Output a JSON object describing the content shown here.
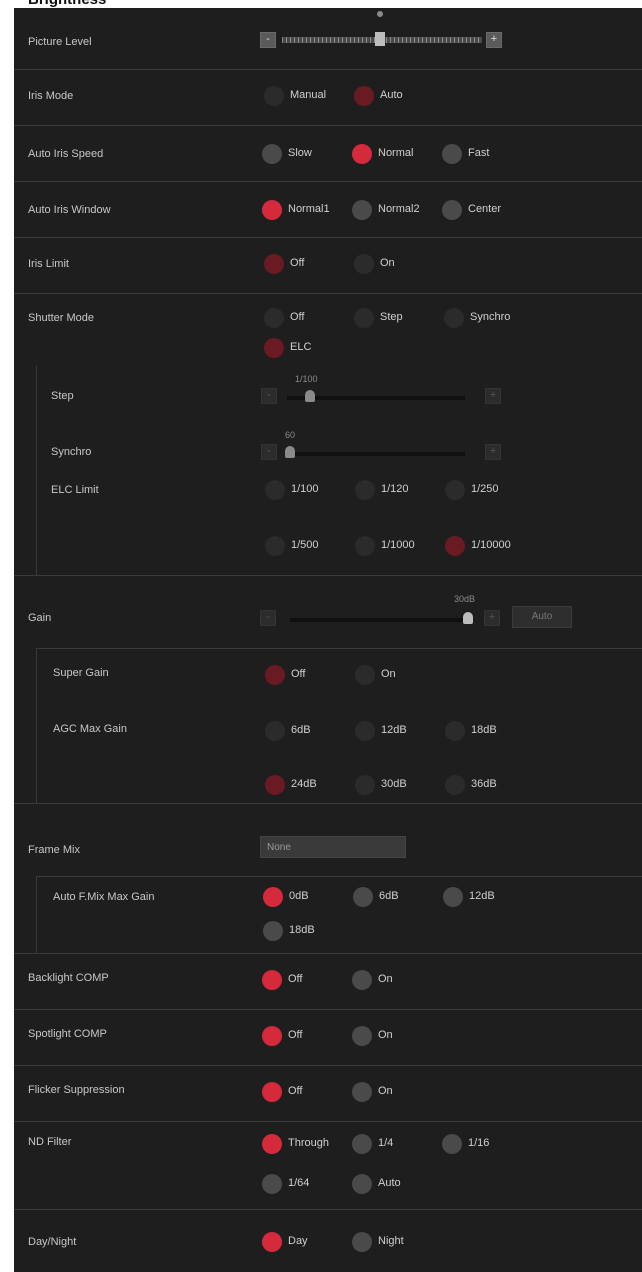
{
  "header": {
    "title": "Brightness"
  },
  "picture_level": {
    "label": "Picture Level",
    "minus": "-",
    "plus": "+"
  },
  "iris_mode": {
    "label": "Iris Mode",
    "options": [
      "Manual",
      "Auto"
    ],
    "selected": "Auto"
  },
  "auto_iris_speed": {
    "label": "Auto Iris Speed",
    "options": [
      "Slow",
      "Normal",
      "Fast"
    ],
    "selected": "Normal"
  },
  "auto_iris_window": {
    "label": "Auto Iris Window",
    "options": [
      "Normal1",
      "Normal2",
      "Center"
    ],
    "selected": "Normal1"
  },
  "iris_limit": {
    "label": "Iris Limit",
    "options": [
      "Off",
      "On"
    ],
    "selected": "Off"
  },
  "shutter_mode": {
    "label": "Shutter Mode",
    "options": [
      "Off",
      "Step",
      "Synchro",
      "ELC"
    ],
    "selected": "ELC"
  },
  "step": {
    "label": "Step",
    "value": "1/100",
    "minus": "-",
    "plus": "+"
  },
  "synchro": {
    "label": "Synchro",
    "value": "60",
    "minus": "-",
    "plus": "+"
  },
  "elc_limit": {
    "label": "ELC Limit",
    "options": [
      "1/100",
      "1/120",
      "1/250",
      "1/500",
      "1/1000",
      "1/10000"
    ],
    "selected": "1/10000"
  },
  "gain": {
    "label": "Gain",
    "value": "30dB",
    "minus": "-",
    "plus": "+",
    "auto_label": "Auto"
  },
  "super_gain": {
    "label": "Super Gain",
    "options": [
      "Off",
      "On"
    ],
    "selected": "Off"
  },
  "agc_max_gain": {
    "label": "AGC Max Gain",
    "options": [
      "6dB",
      "12dB",
      "18dB",
      "24dB",
      "30dB",
      "36dB"
    ],
    "selected": "24dB"
  },
  "frame_mix": {
    "label": "Frame Mix",
    "value": "None"
  },
  "auto_f_mix_max_gain": {
    "label": "Auto F.Mix Max Gain",
    "options": [
      "0dB",
      "6dB",
      "12dB",
      "18dB"
    ],
    "selected": "0dB"
  },
  "backlight_comp": {
    "label": "Backlight COMP",
    "options": [
      "Off",
      "On"
    ],
    "selected": "Off"
  },
  "spotlight_comp": {
    "label": "Spotlight COMP",
    "options": [
      "Off",
      "On"
    ],
    "selected": "Off"
  },
  "flicker_suppression": {
    "label": "Flicker Suppression",
    "options": [
      "Off",
      "On"
    ],
    "selected": "Off"
  },
  "nd_filter": {
    "label": "ND Filter",
    "options": [
      "Through",
      "1/4",
      "1/16",
      "1/64",
      "Auto"
    ],
    "selected": "Through"
  },
  "day_night": {
    "label": "Day/Night",
    "options": [
      "Day",
      "Night"
    ],
    "selected": "Day"
  },
  "colors": {
    "panel": "#1e1e1e",
    "accent": "#d42a3c",
    "radio_off": "#4a4a4a",
    "text": "#c8c8c8"
  }
}
